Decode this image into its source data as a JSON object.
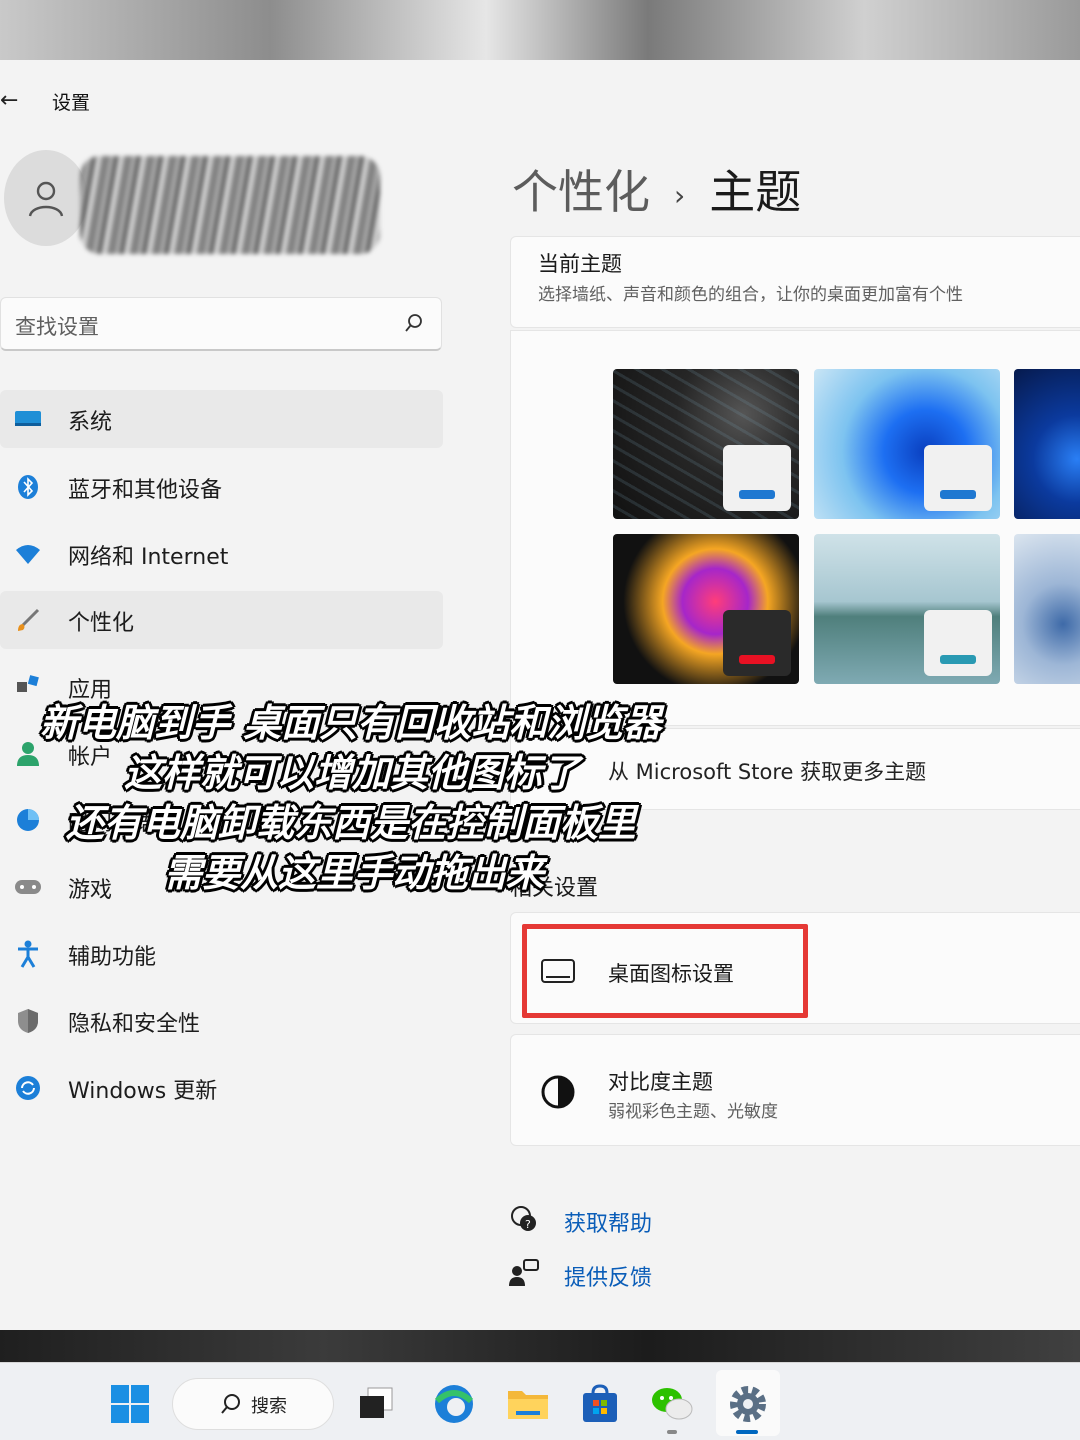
{
  "window": {
    "title": "设置"
  },
  "search": {
    "placeholder": "查找设置"
  },
  "sidebar": {
    "items": [
      {
        "label": "系统"
      },
      {
        "label": "蓝牙和其他设备"
      },
      {
        "label": "网络和 Internet"
      },
      {
        "label": "个性化"
      },
      {
        "label": "应用"
      },
      {
        "label": "帐户"
      },
      {
        "label": "时间和语言"
      },
      {
        "label": "游戏"
      },
      {
        "label": "辅助功能"
      },
      {
        "label": "隐私和安全性"
      },
      {
        "label": "Windows 更新"
      }
    ]
  },
  "main": {
    "breadcrumb": {
      "parent": "个性化",
      "separator": "›",
      "current": "主题"
    },
    "current_theme": {
      "title": "当前主题",
      "subtitle": "选择墙纸、声音和颜色的组合，让你的桌面更加富有个性"
    },
    "store_link": "从 Microsoft Store 获取更多主题",
    "related_settings": {
      "heading": "相关设置",
      "desktop_icons": {
        "label": "桌面图标设置"
      },
      "contrast": {
        "label": "对比度主题",
        "description": "弱视彩色主题、光敏度"
      }
    },
    "help": {
      "get_help": "获取帮助",
      "feedback": "提供反馈"
    }
  },
  "caption": [
    "新电脑到手 桌面只有回收站和浏览器",
    "这样就可以增加其他图标了",
    "还有电脑卸载东西是在控制面板里",
    "需要从这里手动拖出来"
  ],
  "taskbar": {
    "search_label": "搜索"
  },
  "colors": {
    "accent": "#0067c0",
    "highlight_box": "#e53935",
    "link": "#0a5db8"
  }
}
